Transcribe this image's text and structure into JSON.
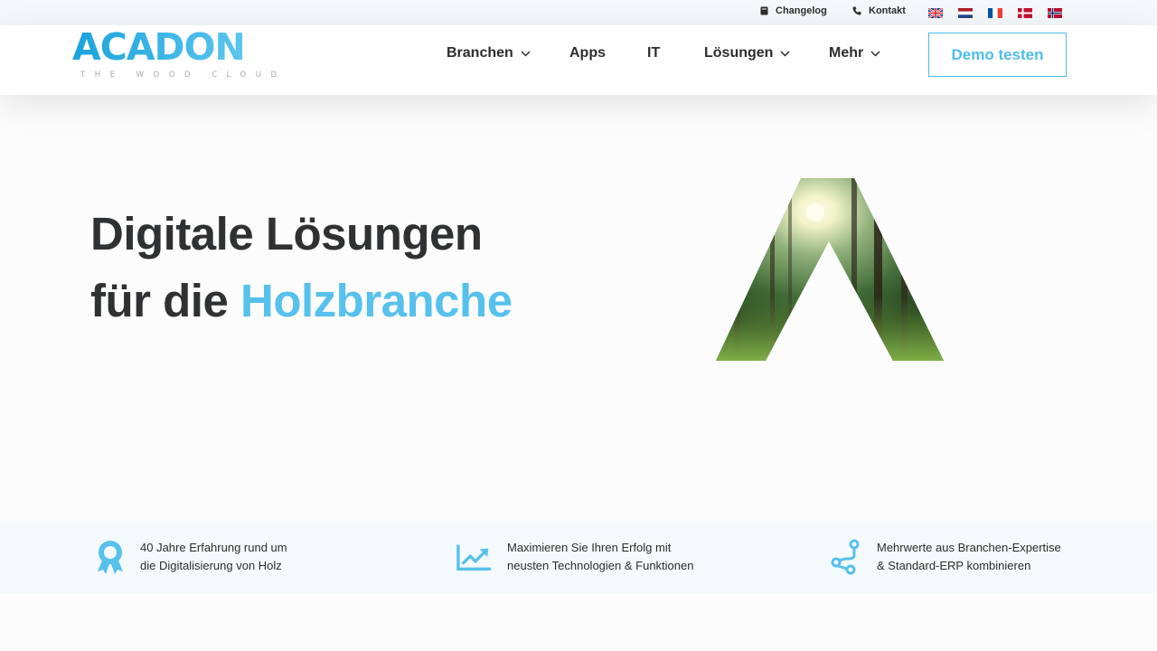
{
  "topbar": {
    "changelog_label": "Changelog",
    "kontakt_label": "Kontakt",
    "languages": [
      "English",
      "Nederlands",
      "Français",
      "Dansk",
      "Norsk"
    ]
  },
  "header": {
    "logo_text": "ACADON",
    "logo_tagline": "THE WOOD CLOUD",
    "nav": {
      "branchen": "Branchen",
      "apps": "Apps",
      "it": "IT",
      "loesungen": "Lösungen",
      "mehr": "Mehr"
    },
    "demo_button": "Demo testen"
  },
  "hero": {
    "line1": "Digitale Lösungen",
    "line2_prefix": "für die ",
    "line2_accent": "Holzbranche"
  },
  "features": [
    {
      "icon": "award-ribbon-icon",
      "line1": "40 Jahre Erfahrung rund um",
      "line2": "die Digitalisierung von Holz"
    },
    {
      "icon": "trending-chart-icon",
      "line1": "Maximieren Sie Ihren Erfolg mit",
      "line2": "neusten Technologien & Funktionen"
    },
    {
      "icon": "git-branch-icon",
      "line1": "Mehrwerte aus Branchen-Expertise",
      "line2": "& Standard-ERP kombinieren"
    }
  ],
  "colors": {
    "accent": "#56c1ec",
    "text": "#2f3133",
    "strip_bg": "#f4f9fb"
  }
}
